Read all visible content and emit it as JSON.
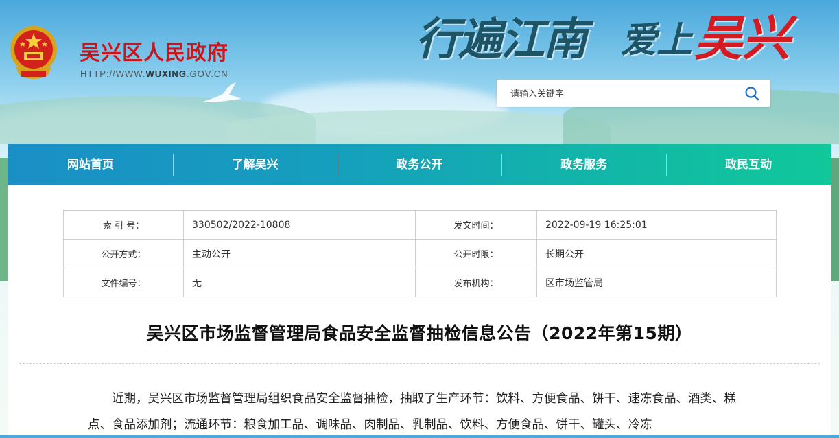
{
  "header": {
    "site_title": "吴兴区人民政府",
    "site_url_prefix": "HTTP://WWW.",
    "site_url_domain": "WUXING",
    "site_url_suffix": ".GOV.CN",
    "slogan_part1": "行遍江南",
    "slogan_part2": "爱上",
    "slogan_part3": "吴兴",
    "emblem_icon": "national-emblem-icon"
  },
  "search": {
    "placeholder": "请输入关键字",
    "icon": "search-icon"
  },
  "nav": {
    "items": [
      {
        "label": "网站首页"
      },
      {
        "label": "了解吴兴"
      },
      {
        "label": "政务公开"
      },
      {
        "label": "政务服务"
      },
      {
        "label": "政民互动"
      }
    ]
  },
  "meta": {
    "index_label": "索 引 号：",
    "index_value": "330502/2022-10808",
    "date_label": "发文时间：",
    "date_value": "2022-09-19 16:25:01",
    "mode_label": "公开方式：",
    "mode_value": "主动公开",
    "period_label": "公开时限：",
    "period_value": "长期公开",
    "docno_label": "文件编号：",
    "docno_value": "无",
    "org_label": "发布机构：",
    "org_value": "区市场监管局"
  },
  "article": {
    "title": "吴兴区市场监督管理局食品安全监督抽检信息公告（2022年第15期）",
    "body": "近期，吴兴区市场监督管理局组织食品安全监督抽检，抽取了生产环节：饮料、方便食品、饼干、速冻食品、酒类、糕点、食品添加剂；流通环节：粮食加工品、调味品、肉制品、乳制品、饮料、方便食品、饼干、罐头、冷冻"
  },
  "colors": {
    "brand_red": "#c8161d",
    "nav_start": "#1a8fc6",
    "nav_end": "#10c89a"
  }
}
